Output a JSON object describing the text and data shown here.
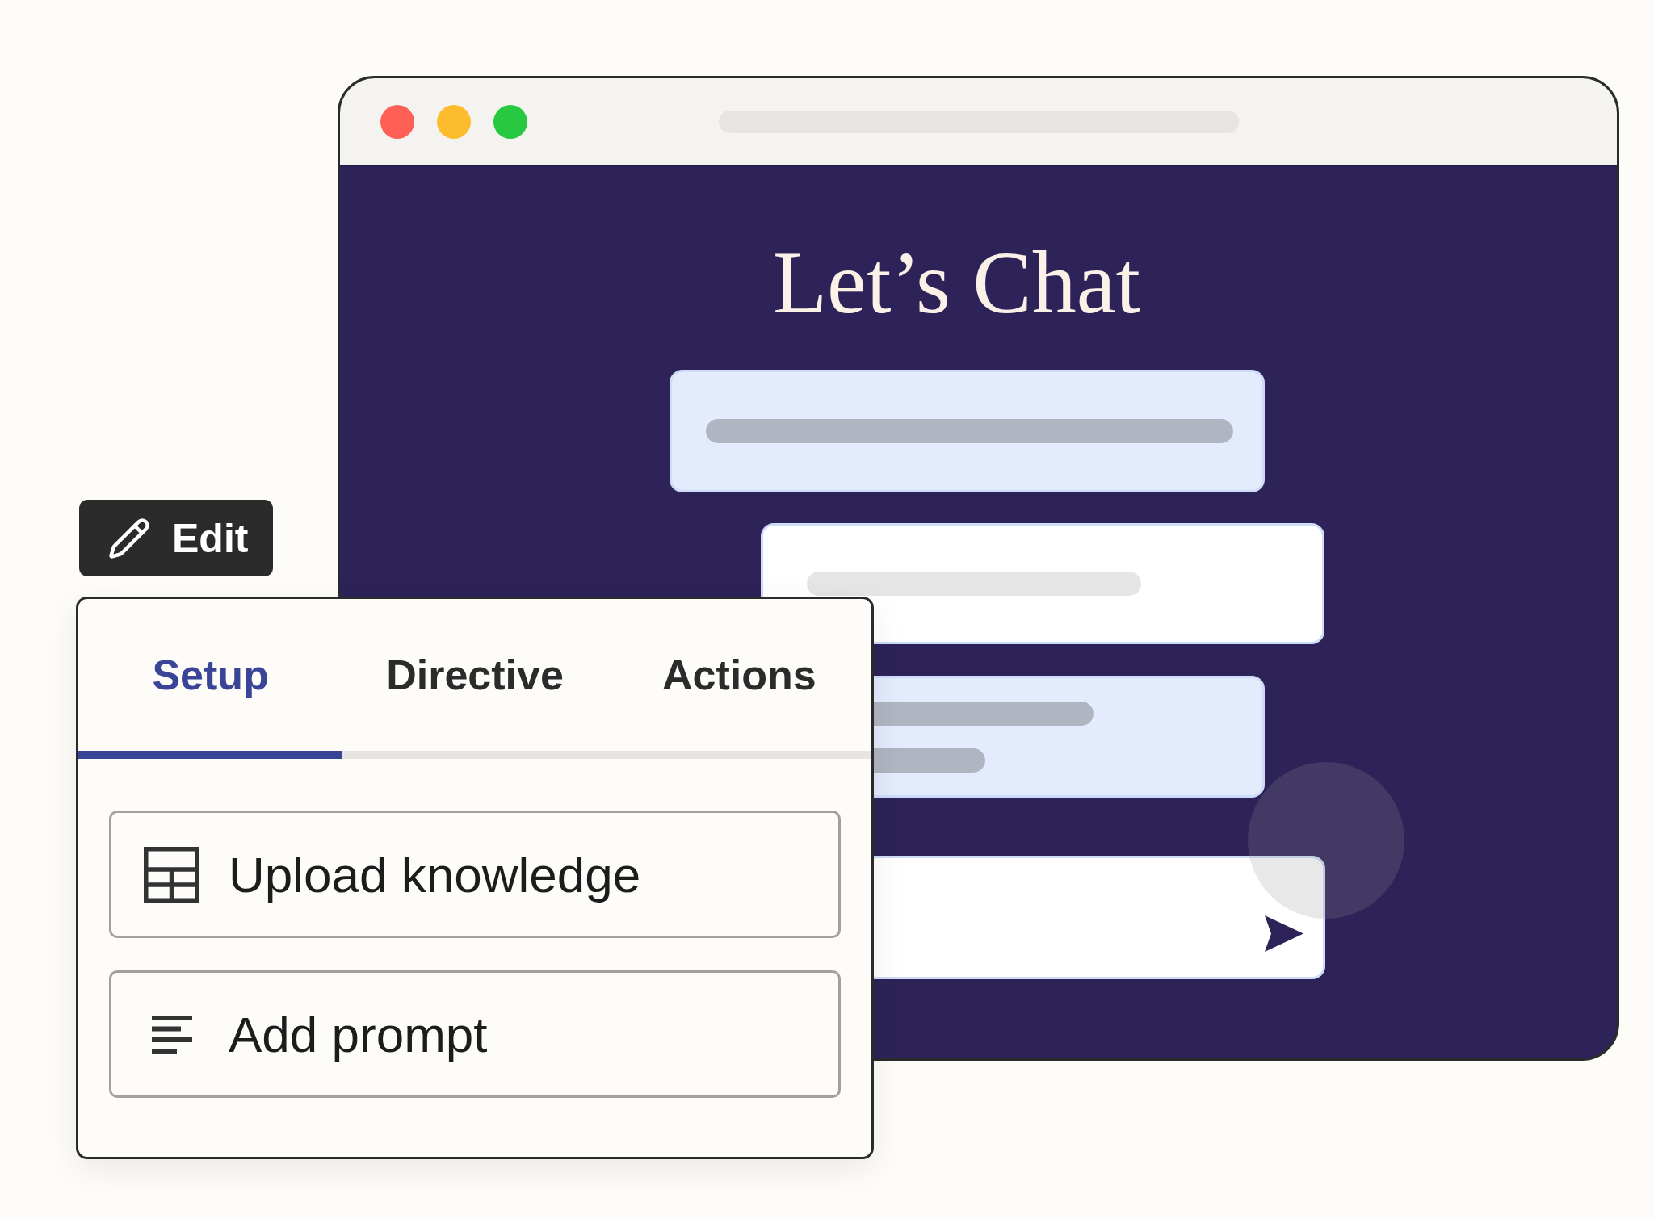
{
  "chat_window": {
    "title": "Let’s Chat"
  },
  "edit_button": {
    "label": "Edit"
  },
  "panel": {
    "tabs": [
      {
        "label": "Setup",
        "selected": true
      },
      {
        "label": "Directive",
        "selected": false
      },
      {
        "label": "Actions",
        "selected": false
      }
    ],
    "items": [
      {
        "kind": "upload",
        "label": "Upload knowledge"
      },
      {
        "kind": "prompt",
        "label": "Add prompt"
      }
    ]
  }
}
